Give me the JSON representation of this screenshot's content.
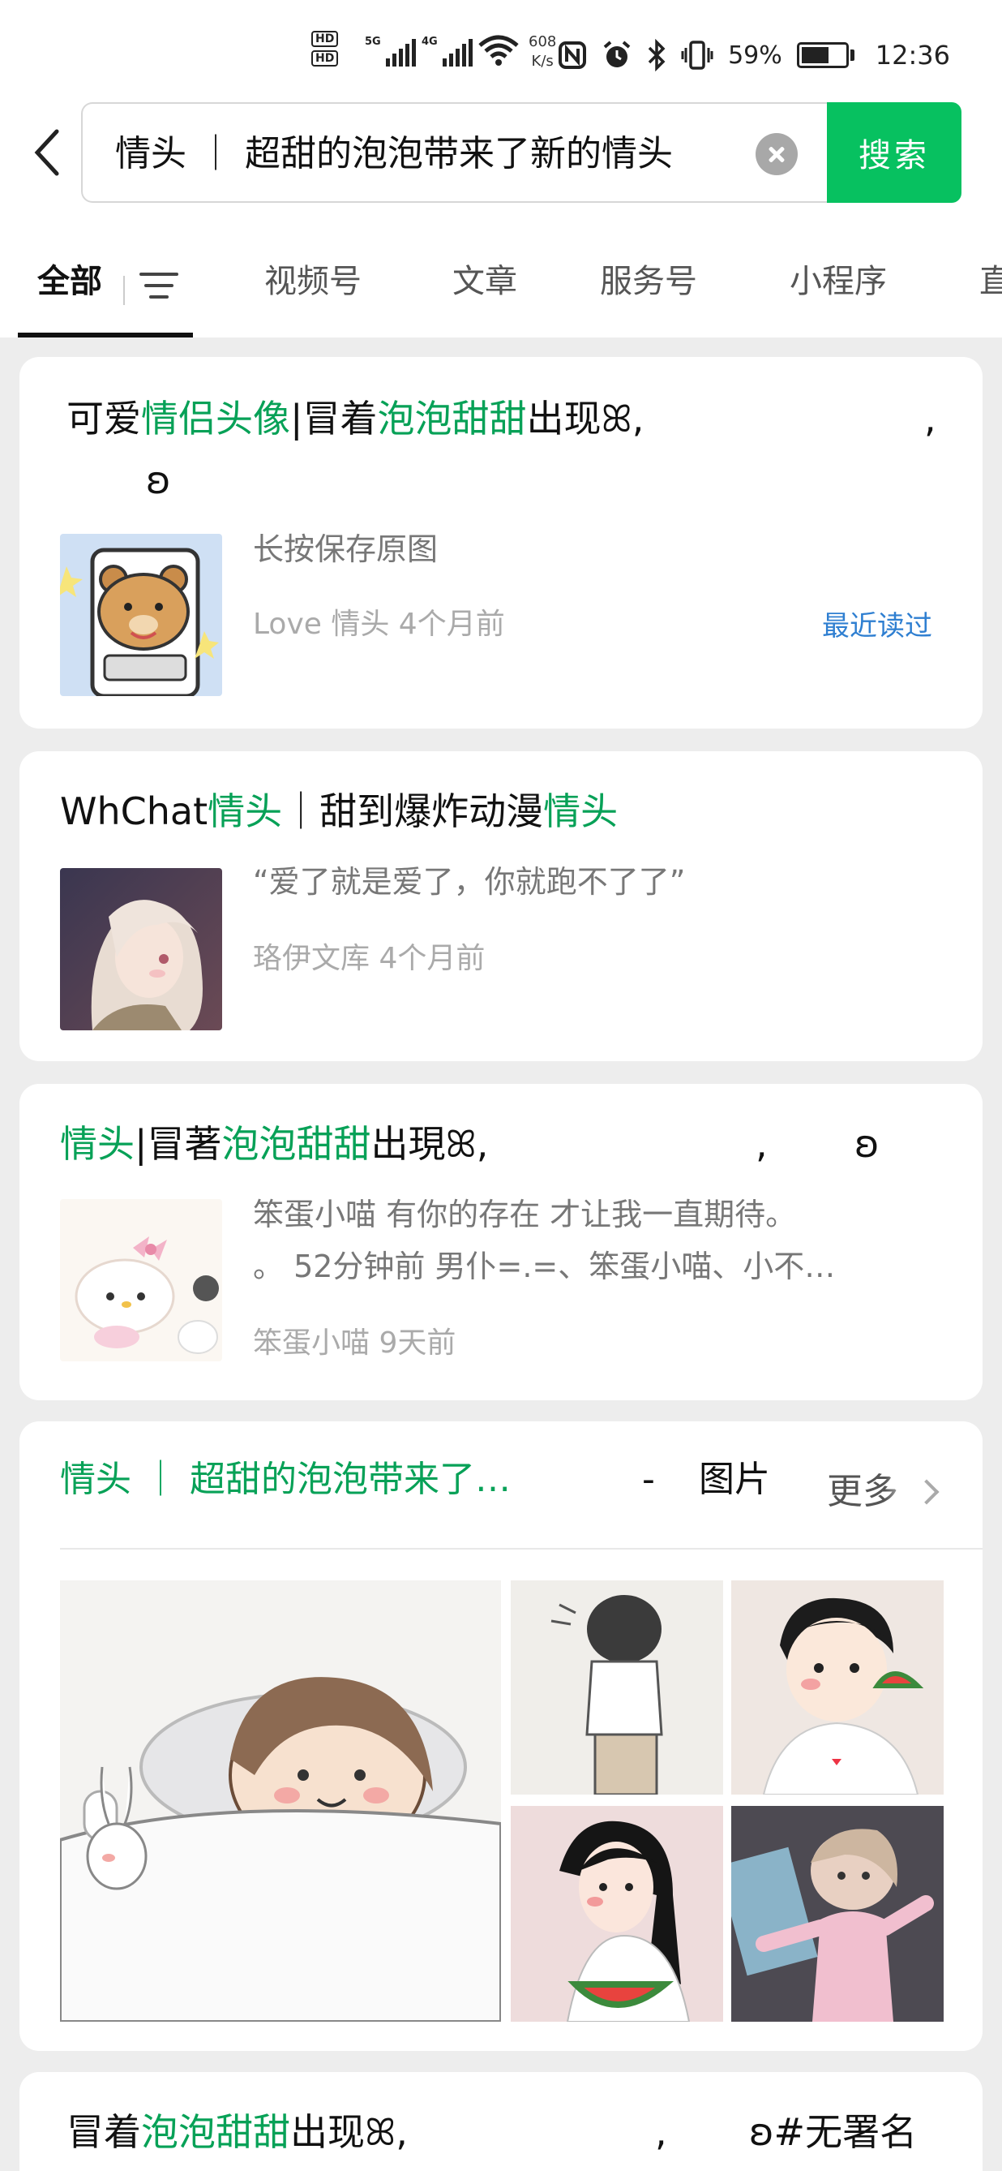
{
  "status_bar": {
    "hd1": "HD",
    "hd2": "HD",
    "sim1_net": "5G",
    "sim2_net": "4G",
    "wifi_label": "6",
    "speed_value": "608",
    "speed_unit": "K/s",
    "battery": "59%",
    "time": "12:36"
  },
  "search": {
    "query": "情头 ｜ 超甜的泡泡带来了新的情头",
    "button": "搜索"
  },
  "tabs": [
    {
      "label": "全部"
    },
    {
      "label": "视频号"
    },
    {
      "label": "文章"
    },
    {
      "label": "服务号"
    },
    {
      "label": "小程序"
    },
    {
      "label": "直"
    }
  ],
  "results": [
    {
      "title_pre": "可爱",
      "title_hl1": "情侣头像",
      "title_mid": "|冒着",
      "title_hl2": "泡泡甜甜",
      "title_post": "出现ꕤ,",
      "title_tail1": ",",
      "title_line2": "ʚ",
      "desc": "长按保存原图",
      "meta": "Love  情头  4个月前",
      "badge": "最近读过"
    },
    {
      "title_pre": "WhChat",
      "title_hl1": "情头",
      "title_mid": "｜甜到爆炸动漫",
      "title_hl2": "情头",
      "desc": "“爱了就是爱了，你就跑不了了”",
      "meta": "珞伊文库  4个月前"
    },
    {
      "title_hl1": "情头",
      "title_mid": "|冒著",
      "title_hl2": "泡泡甜甜",
      "title_post": "出現ꕤ,",
      "title_tail1": ",",
      "title_tail2": "ʚ",
      "desc_line1": "笨蛋小喵  有你的存在  才让我一直期待。",
      "desc_line2": "。 52分钟前  男仆=.=、笨蛋小喵、小不…",
      "meta": "笨蛋小喵  9天前"
    },
    {
      "title_hl": "情头 ｜ 超甜的泡泡带来了…",
      "sep": "-",
      "type": "图片",
      "more": "更多"
    },
    {
      "title_pre": "冒着",
      "title_hl": "泡泡甜甜",
      "title_post": "出现ꕤ,",
      "title_tail1": ",",
      "title_tail2": "ʚ#无署名"
    }
  ]
}
